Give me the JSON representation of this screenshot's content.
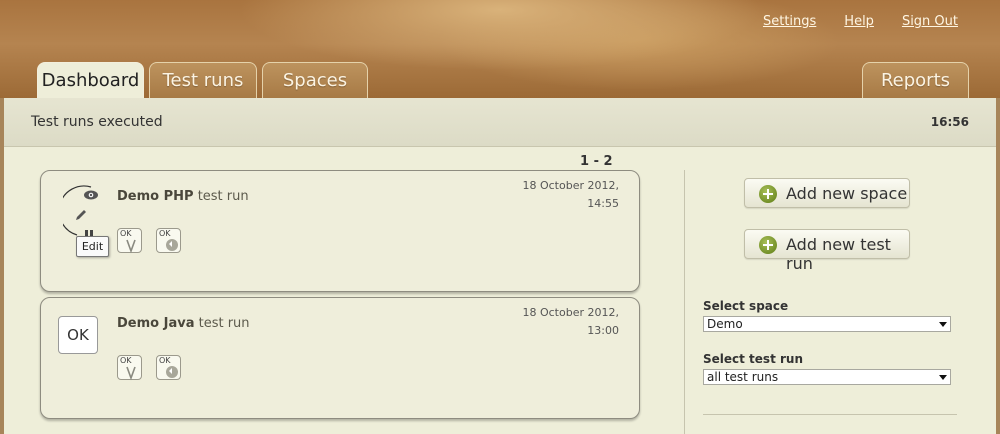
{
  "header": {
    "links": {
      "settings": "Settings",
      "help": "Help",
      "sign_out": "Sign Out"
    },
    "tabs": {
      "dashboard": "Dashboard",
      "test_runs": "Test runs",
      "spaces": "Spaces",
      "reports": "Reports"
    },
    "active_tab": "Dashboard"
  },
  "subbar": {
    "title": "Test runs executed",
    "time": "16:56"
  },
  "pager": "1 - 2",
  "runs": [
    {
      "name": "Demo PHP",
      "suffix": "test run",
      "date": "18 October 2012,",
      "time": "14:55",
      "tooltip": "Edit",
      "badges": [
        {
          "label": "OK",
          "icon": "check-v-icon"
        },
        {
          "label": "OK",
          "icon": "refresh-icon"
        }
      ]
    },
    {
      "name": "Demo Java",
      "suffix": "test run",
      "date": "18 October 2012,",
      "time": "13:00",
      "status": "OK",
      "badges": [
        {
          "label": "OK",
          "icon": "check-v-icon"
        },
        {
          "label": "OK",
          "icon": "refresh-icon"
        }
      ]
    }
  ],
  "sidebar": {
    "add_space": "Add new space",
    "add_test_run": "Add new test run",
    "select_space_label": "Select space",
    "select_space_value": "Demo",
    "select_run_label": "Select test run",
    "select_run_value": "all test runs"
  },
  "colors": {
    "accent_green": "#6c8a22",
    "header_brown": "#a9743f",
    "background": "#eeeed9"
  }
}
